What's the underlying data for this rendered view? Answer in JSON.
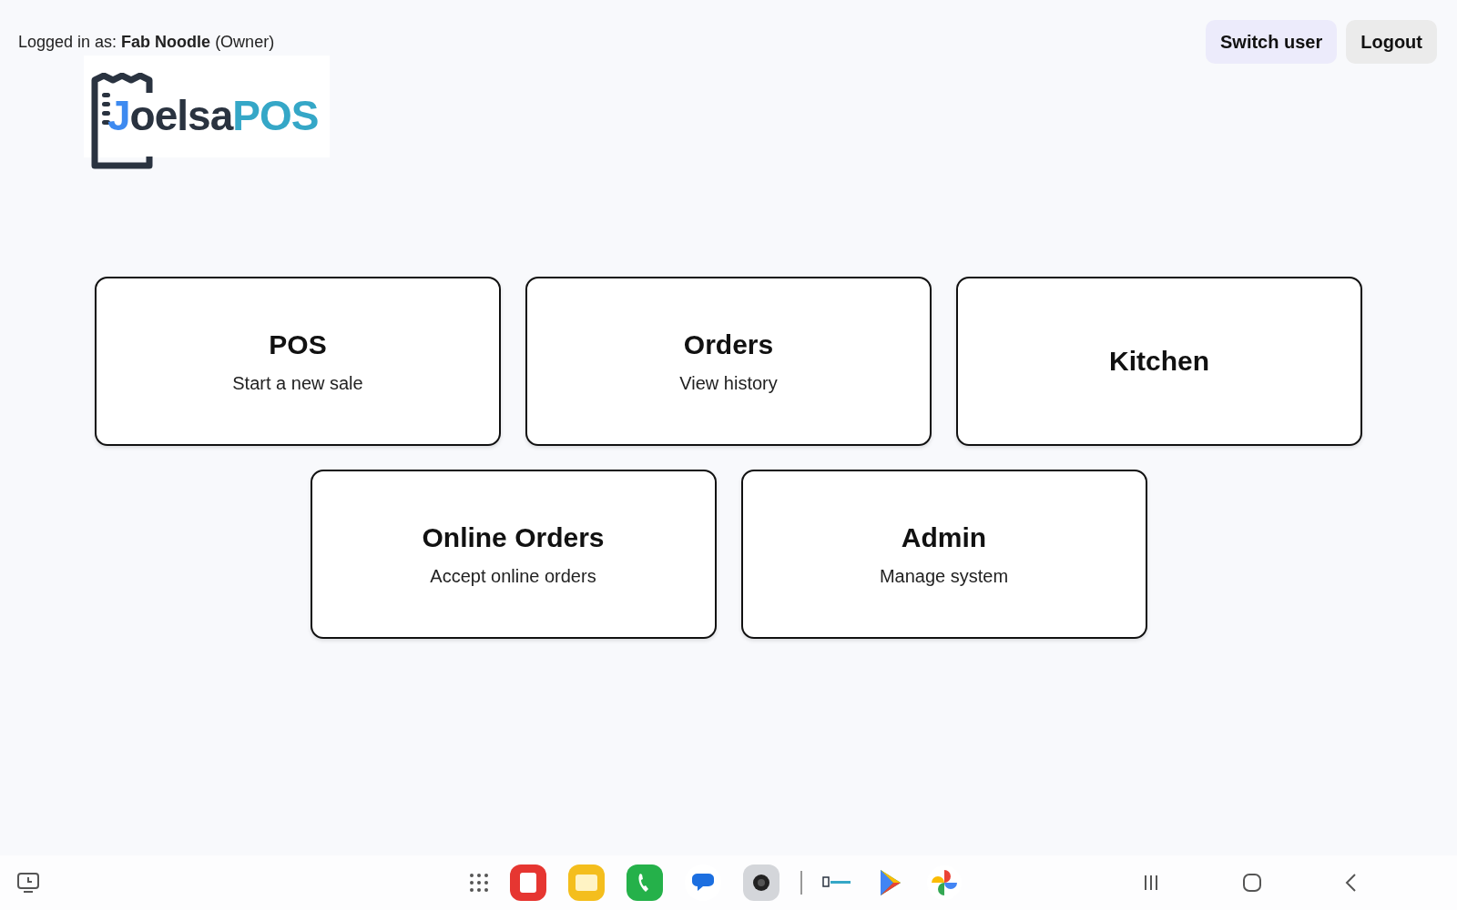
{
  "header": {
    "logged_in_prefix": "Logged in as:",
    "user_name": "Fab Noodle",
    "role": "(Owner)",
    "buttons": [
      {
        "label": "Switch user",
        "kind": "primary"
      },
      {
        "label": "Logout",
        "kind": "secondary"
      }
    ]
  },
  "logo": {
    "initial": "J",
    "name": "oelsa",
    "suffix": "POS"
  },
  "tiles": [
    {
      "title": "POS",
      "subtitle": "Start a new sale"
    },
    {
      "title": "Orders",
      "subtitle": "View history"
    },
    {
      "title": "Kitchen"
    },
    {
      "title": "Online Orders",
      "subtitle": "Accept online orders"
    },
    {
      "title": "Admin",
      "subtitle": "Manage system"
    }
  ]
}
